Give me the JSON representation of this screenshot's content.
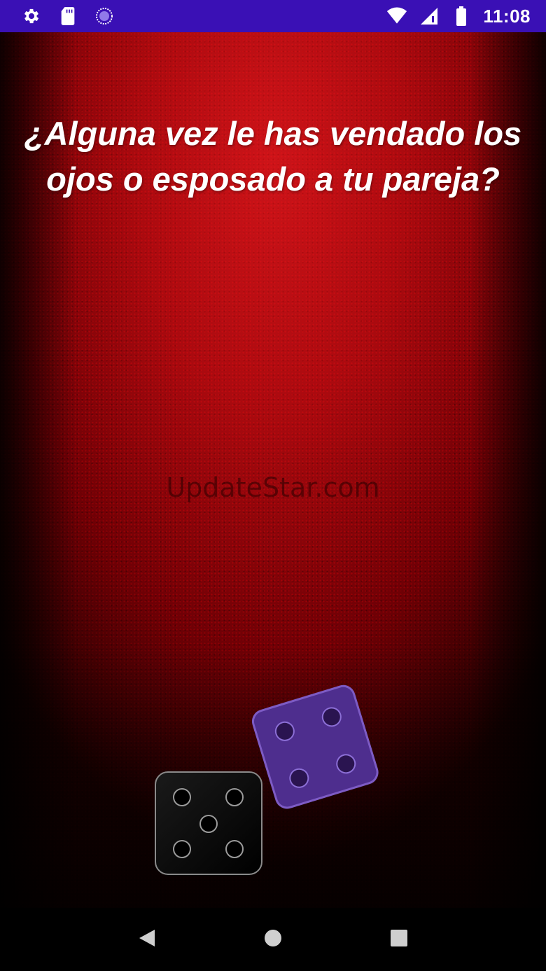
{
  "status_bar": {
    "time": "11:08",
    "icons": [
      "settings-icon",
      "sd-card-icon",
      "sync-icon",
      "wifi-icon",
      "signal-icon",
      "battery-icon"
    ]
  },
  "game": {
    "question": "¿Alguna vez le has vendado los ojos o esposado a tu pareja?",
    "watermark": "UpdateStar.com",
    "dice": [
      {
        "name": "black-die",
        "value": 5,
        "color": "#0a0a0a"
      },
      {
        "name": "purple-die",
        "value": 4,
        "color": "#4e2e8e"
      }
    ]
  },
  "nav_bar": {
    "buttons": [
      "back-icon",
      "home-icon",
      "recents-icon"
    ]
  },
  "colors": {
    "status_bar": "#3a10b5",
    "felt": "#b80a10",
    "text": "#ffffff"
  }
}
